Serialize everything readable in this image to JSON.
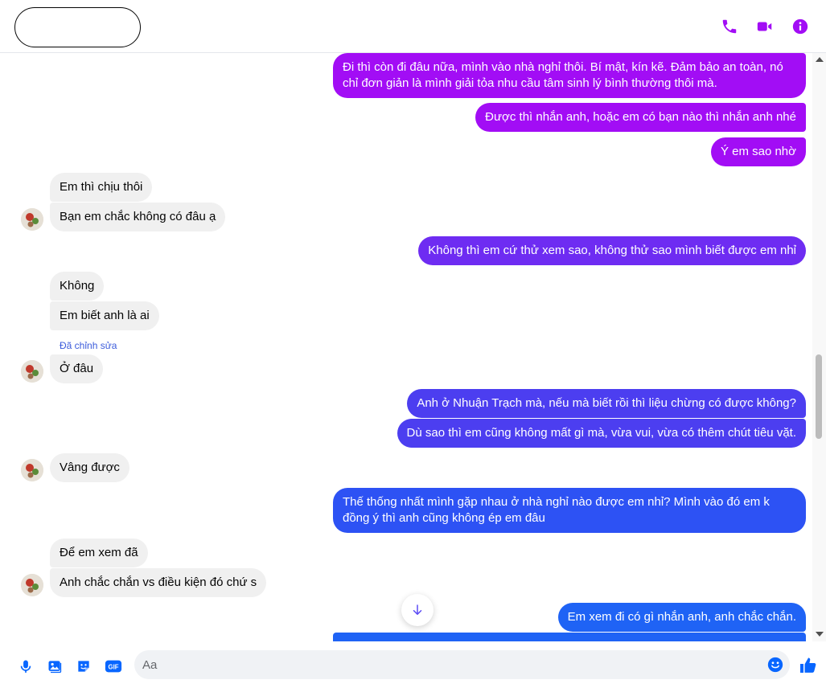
{
  "colors": {
    "accent": "#0866ff",
    "purple": "#a20df5",
    "violet": "#6e2cf2",
    "indigo": "#4c3ef0",
    "blue": "#1f63f5",
    "incoming_bg": "#f0f0f0"
  },
  "header": {
    "contact_name": "",
    "icons": [
      "phone-icon",
      "video-camera-icon",
      "info-icon"
    ]
  },
  "messages": [
    {
      "dir": "out",
      "text": "Đi thì còn đi đâu nữa, mình vào nhà nghỉ thôi. Bí mật, kín kẽ. Đảm bảo an toàn, nó chỉ đơn giản là mình giải tỏa nhu cầu tâm sinh lý bình thường thôi mà."
    },
    {
      "dir": "out",
      "text": "Được thì nhắn anh, hoặc em có bạn nào thì nhắn anh nhé"
    },
    {
      "dir": "out",
      "text": "Ý em sao nhờ"
    },
    {
      "dir": "in",
      "text": "Em thì chịu thôi"
    },
    {
      "dir": "in",
      "text": "Bạn em chắc không có đâu ạ"
    },
    {
      "dir": "out",
      "text": "Không thì em cứ thử xem sao, không thử sao mình biết được em nhỉ"
    },
    {
      "dir": "in",
      "text": "Không"
    },
    {
      "dir": "in",
      "text": "Em biết anh là ai"
    },
    {
      "dir": "in",
      "text": "Ở đâu",
      "edited_label": "Đã chỉnh sửa"
    },
    {
      "dir": "out",
      "text": "Anh ở Nhuận Trạch mà, nếu mà biết rồi thì liệu chừng có được không?"
    },
    {
      "dir": "out",
      "text": "Dù sao thì em cũng không mất gì mà, vừa vui, vừa có thêm chút tiêu vặt."
    },
    {
      "dir": "in",
      "text": "Vâng được"
    },
    {
      "dir": "out",
      "text": "Thế thống nhất mình gặp nhau ở nhà nghỉ nào được em nhỉ? Mình vào đó em k đồng ý thì anh cũng không ép em đâu"
    },
    {
      "dir": "in",
      "text": "Để em xem đã"
    },
    {
      "dir": "in",
      "text": "Anh chắc chắn vs điều kiện đó chứ s"
    },
    {
      "dir": "out",
      "text": "Em xem đi có gì nhắn anh, anh chắc chắn."
    },
    {
      "dir": "out",
      "text": ""
    }
  ],
  "composer": {
    "placeholder": "Aa",
    "value": "",
    "tools": [
      "microphone-icon",
      "image-icon",
      "sticker-icon",
      "gif-icon"
    ],
    "gif_label": "GIF"
  }
}
